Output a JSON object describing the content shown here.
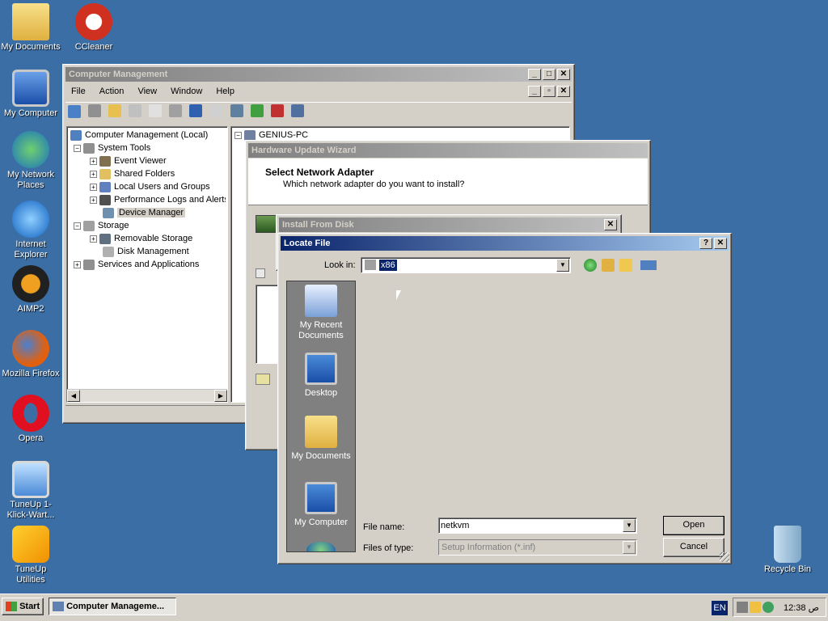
{
  "desktop": {
    "icons": [
      {
        "label": "My Documents",
        "icon": "folder-documents-icon"
      },
      {
        "label": "CCleaner",
        "icon": "ccleaner-icon"
      },
      {
        "label": "My Computer",
        "icon": "computer-icon"
      },
      {
        "label": "My Network Places",
        "icon": "network-places-icon"
      },
      {
        "label": "Internet Explorer",
        "icon": "internet-explorer-icon"
      },
      {
        "label": "AIMP2",
        "icon": "aimp-icon"
      },
      {
        "label": "Mozilla Firefox",
        "icon": "firefox-icon"
      },
      {
        "label": "Opera",
        "icon": "opera-icon"
      },
      {
        "label": "TuneUp 1-Klick-Wart...",
        "icon": "tuneup-maintenance-icon"
      },
      {
        "label": "TuneUp Utilities",
        "icon": "tuneup-utilities-icon"
      },
      {
        "label": "Recycle Bin",
        "icon": "recycle-bin-icon"
      }
    ]
  },
  "computer_management": {
    "title": "Computer Management",
    "menu": [
      "File",
      "Action",
      "View",
      "Window",
      "Help"
    ],
    "tree": [
      {
        "label": "Computer Management (Local)"
      },
      {
        "label": "System Tools"
      },
      {
        "label": "Event Viewer"
      },
      {
        "label": "Shared Folders"
      },
      {
        "label": "Local Users and Groups"
      },
      {
        "label": "Performance Logs and Alerts"
      },
      {
        "label": "Device Manager"
      },
      {
        "label": "Storage"
      },
      {
        "label": "Removable Storage"
      },
      {
        "label": "Disk Management"
      },
      {
        "label": "Services and Applications"
      }
    ],
    "right_root": "GENIUS-PC"
  },
  "hardware_wizard": {
    "title": "Hardware Update Wizard",
    "heading": "Select Network Adapter",
    "subheading": "Which network adapter do you want to install?"
  },
  "install_from_disk": {
    "title": "Install From Disk"
  },
  "locate_file": {
    "title": "Locate File",
    "look_in_label": "Look in:",
    "look_in_value": "x86",
    "places": [
      {
        "label": "My Recent Documents"
      },
      {
        "label": "Desktop"
      },
      {
        "label": "My Documents"
      },
      {
        "label": "My Computer"
      }
    ],
    "file_name_label": "File name:",
    "file_name_value": "netkvm",
    "file_type_label": "Files of type:",
    "file_type_value": "Setup Information (*.inf)",
    "open_label": "Open",
    "cancel_label": "Cancel",
    "help_btn": "?",
    "close_btn": "✕"
  },
  "taskbar": {
    "start_label": "Start",
    "task_label": "Computer Manageme...",
    "lang": "EN",
    "clock": "12:38 ص"
  },
  "colors": {
    "desktop": "#3a6ea5",
    "title_active": "#0a246a",
    "title_inactive": "#808080"
  }
}
